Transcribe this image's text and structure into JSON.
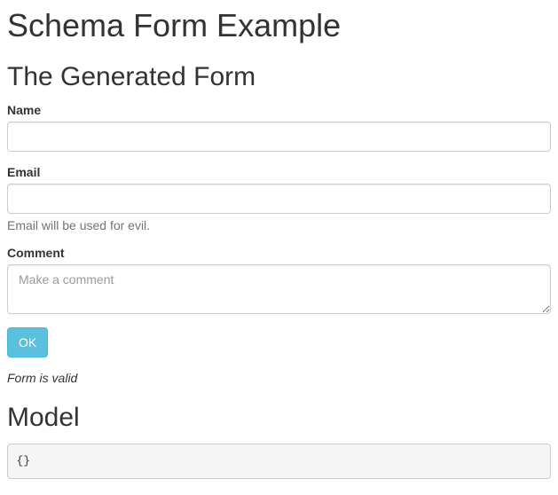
{
  "header": {
    "title": "Schema Form Example"
  },
  "form_section": {
    "heading": "The Generated Form",
    "fields": {
      "name": {
        "label": "Name",
        "value": "",
        "placeholder": ""
      },
      "email": {
        "label": "Email",
        "value": "",
        "placeholder": "",
        "help": "Email will be used for evil."
      },
      "comment": {
        "label": "Comment",
        "value": "",
        "placeholder": "Make a comment"
      }
    },
    "submit_label": "OK",
    "validity_text": "Form is valid"
  },
  "model_section": {
    "heading": "Model",
    "content": "{}"
  }
}
